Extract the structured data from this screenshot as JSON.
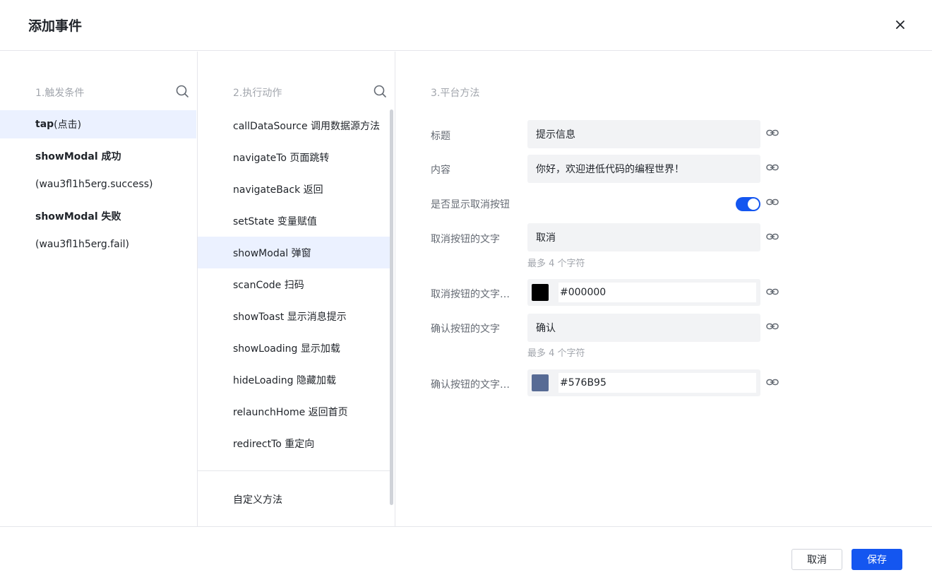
{
  "dialog": {
    "title": "添加事件"
  },
  "triggers": {
    "heading": "1.触发条件",
    "items": [
      {
        "name": "tap",
        "suffix": "(点击)"
      },
      {
        "name": "showModal 成功",
        "sub": "(wau3fl1h5erg.success)"
      },
      {
        "name": "showModal 失败",
        "sub": "(wau3fl1h5erg.fail)"
      }
    ]
  },
  "actions": {
    "heading": "2.执行动作",
    "items": [
      "callDataSource 调用数据源方法",
      "navigateTo 页面跳转",
      "navigateBack 返回",
      "setState 变量赋值",
      "showModal 弹窗",
      "scanCode 扫码",
      "showToast 显示消息提示",
      "showLoading 显示加载",
      "hideLoading 隐藏加载",
      "relaunchHome 返回首页",
      "redirectTo 重定向"
    ],
    "active_index": 4,
    "custom": "自定义方法"
  },
  "platform": {
    "heading": "3.平台方法",
    "title_label": "标题",
    "title_value": "提示信息",
    "content_label": "内容",
    "content_value": "你好，欢迎进低代码的编程世界！",
    "show_cancel_label": "是否显示取消按钮",
    "show_cancel_on": true,
    "cancel_text_label": "取消按钮的文字",
    "cancel_text_value": "取消",
    "cancel_text_hint": "最多 4 个字符",
    "cancel_color_label": "取消按钮的文字颜色",
    "cancel_color_value": "#000000",
    "confirm_text_label": "确认按钮的文字",
    "confirm_text_value": "确认",
    "confirm_text_hint": "最多 4 个字符",
    "confirm_color_label": "确认按钮的文字颜色",
    "confirm_color_value": "#576B95"
  },
  "footer": {
    "cancel_label": "取消",
    "save_label": "保存"
  },
  "colors": {
    "accent": "#1456f0",
    "active_bg": "#ebf1ff"
  }
}
